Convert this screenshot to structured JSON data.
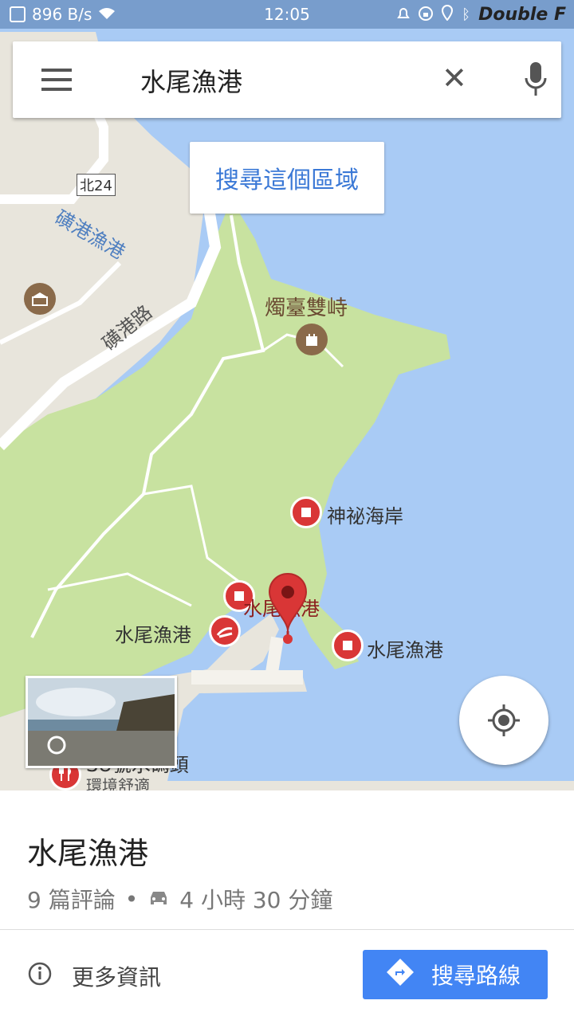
{
  "status": {
    "net_speed": "896 B/s",
    "time": "12:05",
    "watermark": "Double F"
  },
  "search": {
    "query": "水尾漁港",
    "search_area_label": "搜尋這個區域"
  },
  "map": {
    "labels": {
      "road_north24": "北24",
      "harbor": "磺港漁港",
      "road": "磺港路",
      "landmark": "燭臺雙峙",
      "coast": "神祕海岸",
      "port_center": "水尾漁港",
      "port_left": "水尾漁港",
      "port_right": "水尾漁港",
      "restaurant": "SU號水碼頭",
      "restaurant_sub": "環境舒適"
    }
  },
  "place": {
    "title": "水尾漁港",
    "reviews": "9 篇評論",
    "separator": "•",
    "drive_time": "4 小時 30 分鐘",
    "more_info": "更多資訊",
    "directions": "搜尋路線"
  },
  "colors": {
    "water": "#a9cbf5",
    "park": "#c8e2a0",
    "land": "#e8e5dc",
    "road": "#ffffff",
    "accent": "#4285f4",
    "pin": "#d93636"
  },
  "icons": [
    "hamburger-menu-icon",
    "close-icon",
    "microphone-icon",
    "my-location-icon",
    "car-icon",
    "info-icon",
    "directions-icon",
    "museum-icon",
    "castle-icon",
    "restaurant-icon",
    "map-pin-icon"
  ]
}
